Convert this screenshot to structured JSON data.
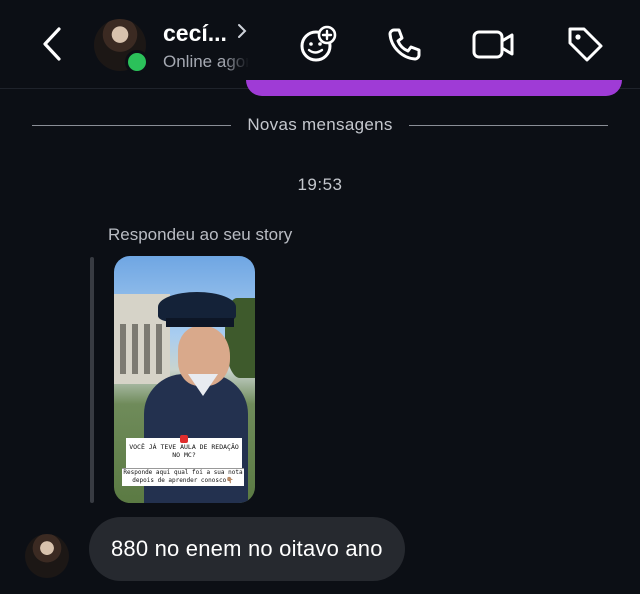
{
  "header": {
    "contact_name": "cecí...",
    "status": "Online agora",
    "icons": [
      "back-icon",
      "effects-icon",
      "phone-icon",
      "video-icon",
      "tag-icon"
    ]
  },
  "thread": {
    "divider_label": "Novas mensagens",
    "timestamp": "19:53",
    "story_reply_label": "Respondeu ao seu story",
    "story": {
      "sticker_question": "VOCÊ JÁ TEVE AULA DE REDAÇÃO NO MC?",
      "sticker_answer": "Responde aqui qual foi a sua nota depois de aprender conosco👇🏽"
    },
    "message": "880 no enem no oitavo ano"
  },
  "colors": {
    "background": "#0c0f15",
    "bubble": "#26292f",
    "online": "#2bc15a",
    "outgoing_bubble": "#9f3bd6"
  }
}
